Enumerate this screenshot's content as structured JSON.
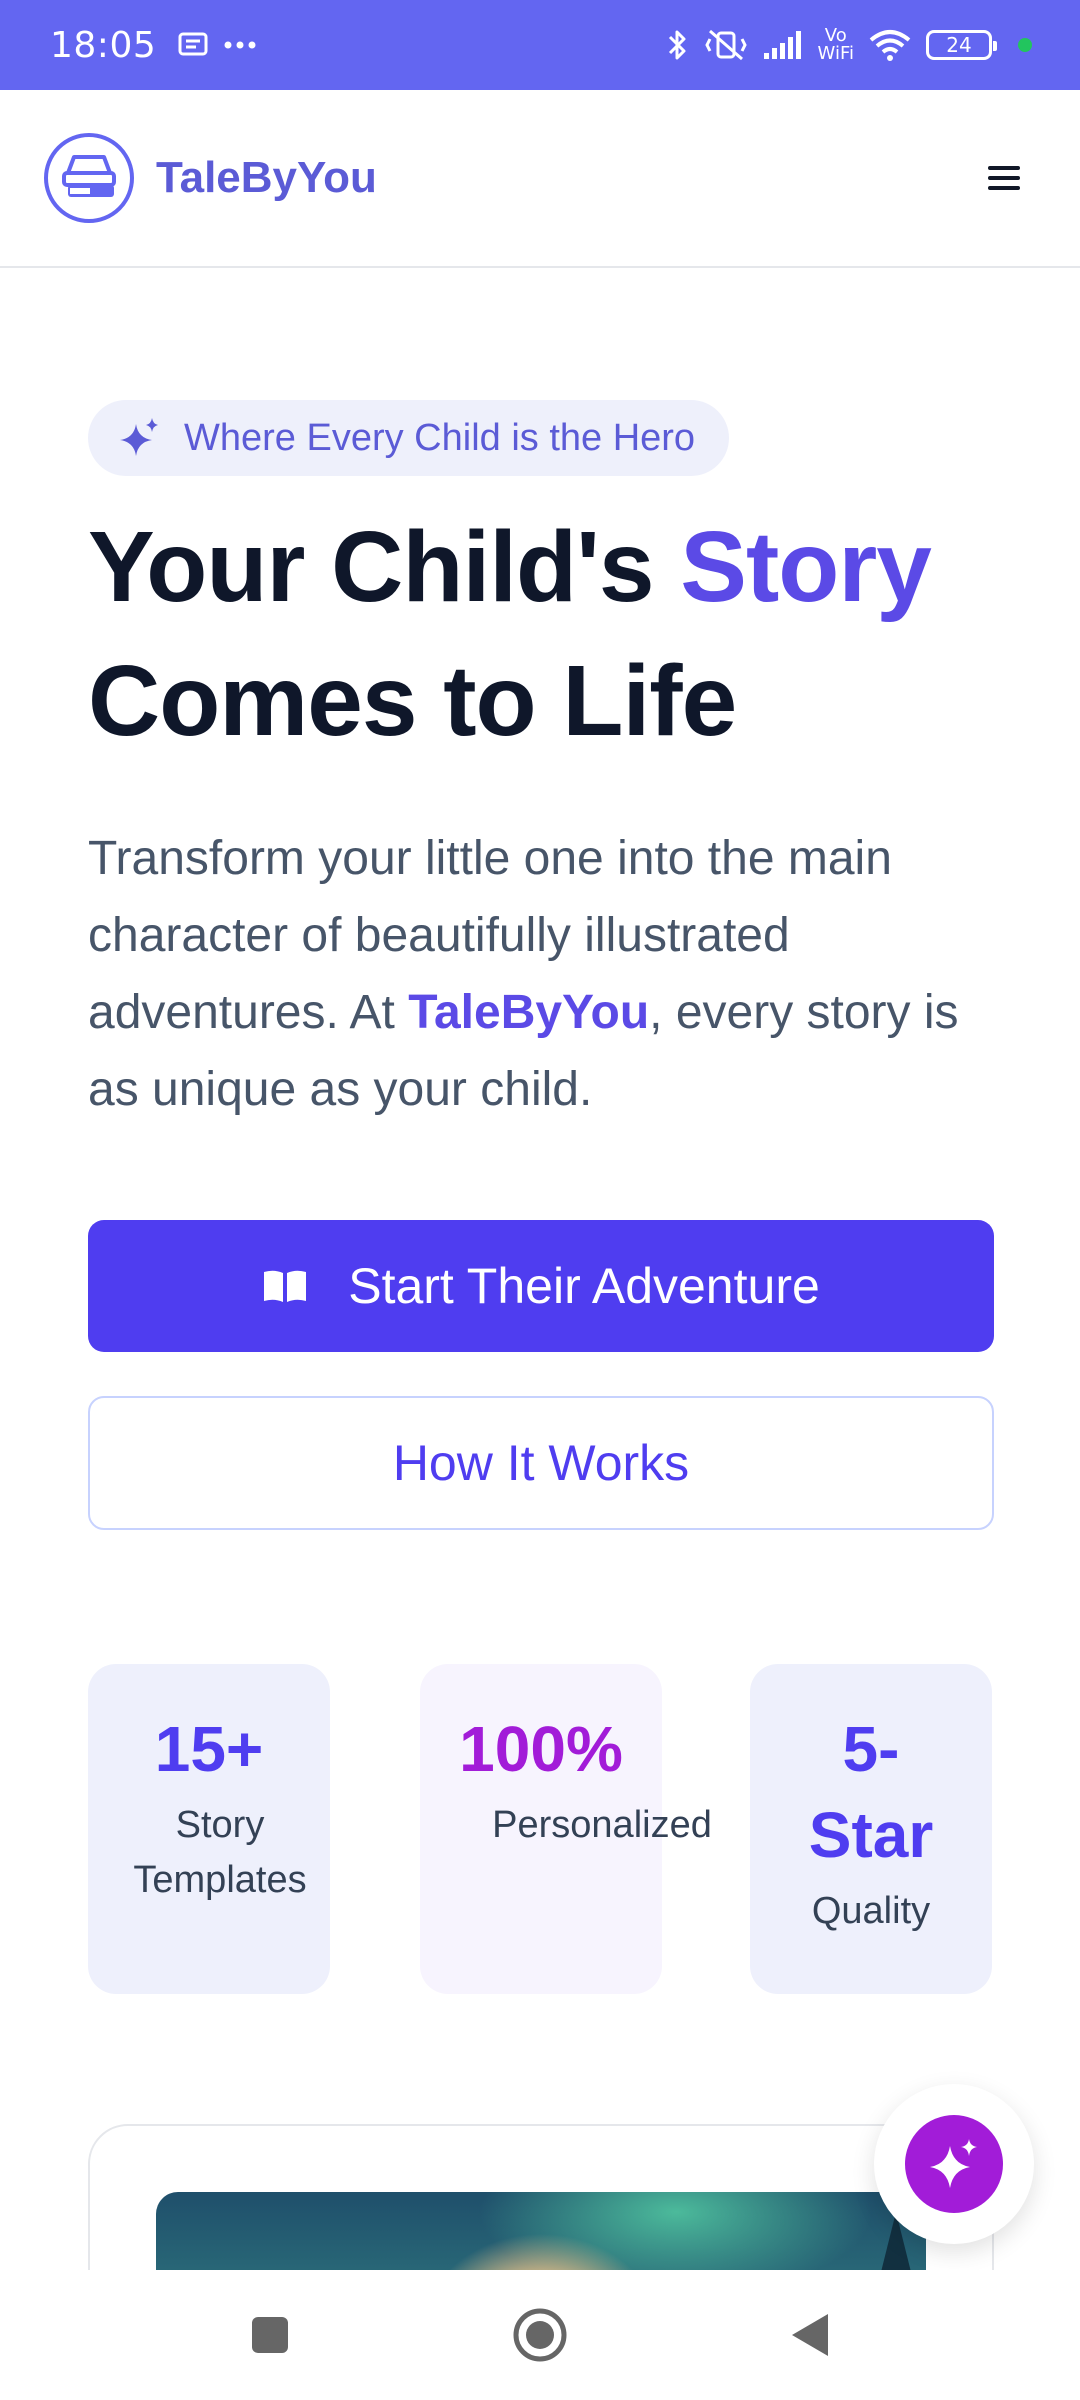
{
  "status_bar": {
    "time": "18:05",
    "battery_level": "24",
    "icons": [
      "message-icon",
      "more-dots-icon",
      "bluetooth-icon",
      "vibrate-off-icon",
      "signal-icon",
      "vowifi-icon",
      "wifi-icon",
      "battery-icon"
    ],
    "vowifi_top": "Vo",
    "vowifi_bottom": "WiFi"
  },
  "header": {
    "brand": "TaleByYou",
    "logo_icon": "book-stack-icon",
    "menu_icon": "hamburger-menu-icon"
  },
  "hero": {
    "badge_text": "Where Every Child is the Hero",
    "title_part1": "Your Child's",
    "title_accent": "Story",
    "title_line2": "Comes to Life",
    "description_before": "Transform your little one into the main character of beautifully illustrated adventures. At ",
    "description_brand": "TaleByYou",
    "description_after": ", every story is as unique as your child.",
    "primary_button": "Start Their Adventure",
    "secondary_button": "How It Works"
  },
  "stats": [
    {
      "value": "15+",
      "label": "Story Templates"
    },
    {
      "value": "100%",
      "label": "Personalized"
    },
    {
      "value_line1": "5-",
      "value_line2": "Star",
      "label": "Quality"
    }
  ],
  "colors": {
    "status_bar": "#6366f1",
    "brand": "#5b5bd6",
    "primary": "#4f3df0",
    "accent_purple": "#a21cd8"
  },
  "fab": {
    "icon": "sparkles-icon"
  },
  "nav_bar": {
    "icons": [
      "recents-square-icon",
      "home-circle-icon",
      "back-triangle-icon"
    ]
  }
}
